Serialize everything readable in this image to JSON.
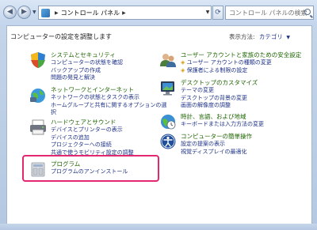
{
  "address_bar": {
    "segments": [
      "コントロール パネル"
    ]
  },
  "search": {
    "placeholder": "コントロール パネルの検索"
  },
  "main": {
    "heading": "コンピューターの設定を調整します",
    "view_by_label": "表示方法:",
    "view_by_value": "カテゴリ"
  },
  "categories_left": [
    {
      "title": "システムとセキュリティ",
      "links": [
        "コンピューターの状態を確認",
        "バックアップの作成",
        "問題の発見と解決"
      ]
    },
    {
      "title": "ネットワークとインターネット",
      "links": [
        "ネットワークの状態とタスクの表示",
        "ホームグループと共有に関するオプションの選",
        "択"
      ]
    },
    {
      "title": "ハードウェアとサウンド",
      "links": [
        "デバイスとプリンターの表示",
        "デバイスの追加",
        "プロジェクターへの接続",
        "共通で使うモビリティ設定の調整"
      ]
    },
    {
      "title": "プログラム",
      "links": [
        "プログラムのアンインストール"
      ]
    }
  ],
  "categories_right": [
    {
      "title": "ユーザー アカウントと家族のための安全設定",
      "links": [
        "ユーザー アカウントの種類の変更",
        "保護者による制限の設定"
      ]
    },
    {
      "title": "デスクトップのカスタマイズ",
      "links": [
        "テーマの変更",
        "デスクトップの背景の変更",
        "画面の解像度の調整"
      ]
    },
    {
      "title": "時計、言語、および地域",
      "links": [
        "キーボードまたは入力方法の変更"
      ]
    },
    {
      "title": "コンピューターの簡単操作",
      "links": [
        "設定の提案の表示",
        "視覚ディスプレイの最適化"
      ]
    }
  ],
  "colors": {
    "highlight": "#e32770",
    "title_green": "#1e6400",
    "link_blue": "#1e3287"
  }
}
